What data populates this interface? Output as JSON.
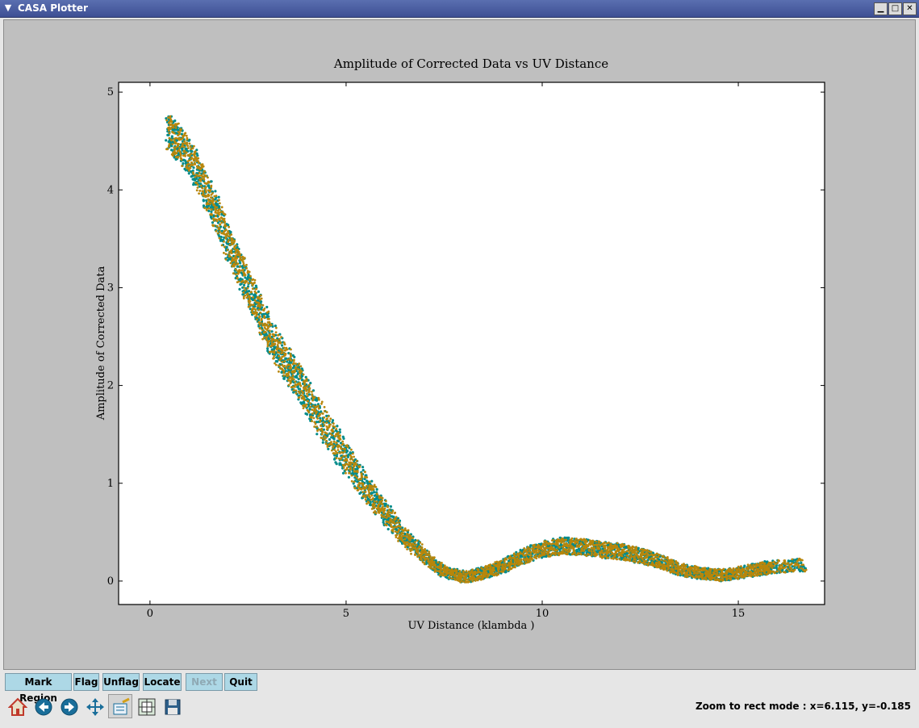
{
  "window": {
    "title": "CASA Plotter"
  },
  "plot": {
    "title": "Amplitude of Corrected Data vs UV Distance",
    "xlabel": "UV Distance (klambda )",
    "ylabel": "Amplitude of Corrected Data"
  },
  "chart_data": {
    "type": "scatter",
    "title": "Amplitude of Corrected Data vs UV Distance",
    "xlabel": "UV Distance (klambda )",
    "ylabel": "Amplitude of Corrected Data",
    "xlim": [
      -0.8,
      17.2
    ],
    "ylim": [
      -0.24,
      5.1
    ],
    "xticks": [
      "0",
      "5",
      "10",
      "15"
    ],
    "yticks": [
      "0",
      "1",
      "2",
      "3",
      "4",
      "5"
    ],
    "grid": false,
    "series": [
      {
        "color": "#008b8b",
        "x": [
          0.45,
          0.8,
          1.2,
          1.6,
          2.0,
          2.4,
          2.8,
          3.2,
          3.6,
          4.0,
          4.5,
          5.0,
          5.5,
          6.0,
          6.5,
          7.0,
          7.5,
          8.0,
          8.5,
          9.0,
          9.5,
          10.0,
          10.5,
          11.0,
          11.5,
          12.0,
          12.5,
          13.0,
          13.5,
          14.0,
          14.5,
          15.0,
          15.5,
          15.8,
          16.7
        ],
        "y": [
          4.6,
          4.45,
          4.2,
          3.85,
          3.45,
          3.1,
          2.75,
          2.4,
          2.15,
          1.9,
          1.55,
          1.25,
          0.95,
          0.7,
          0.45,
          0.25,
          0.1,
          0.04,
          0.08,
          0.15,
          0.25,
          0.32,
          0.36,
          0.35,
          0.32,
          0.3,
          0.26,
          0.2,
          0.12,
          0.08,
          0.06,
          0.08,
          0.12,
          0.14,
          0.17
        ]
      },
      {
        "color": "#b8860b",
        "x": [
          0.45,
          0.8,
          1.2,
          1.6,
          2.0,
          2.4,
          2.8,
          3.2,
          3.6,
          4.0,
          4.5,
          5.0,
          5.5,
          6.0,
          6.5,
          7.0,
          7.5,
          8.0,
          8.5,
          9.0,
          9.5,
          10.0,
          10.5,
          11.0,
          11.5,
          12.0,
          12.5,
          13.0,
          13.5,
          14.0,
          14.5,
          15.0,
          15.5,
          15.8,
          16.7
        ],
        "y": [
          4.6,
          4.45,
          4.2,
          3.85,
          3.45,
          3.1,
          2.75,
          2.4,
          2.15,
          1.9,
          1.55,
          1.25,
          0.95,
          0.7,
          0.45,
          0.25,
          0.1,
          0.04,
          0.08,
          0.15,
          0.25,
          0.32,
          0.36,
          0.35,
          0.32,
          0.3,
          0.26,
          0.2,
          0.12,
          0.08,
          0.06,
          0.08,
          0.12,
          0.14,
          0.17
        ]
      }
    ]
  },
  "buttons": {
    "mark_region": "Mark Region",
    "flag": "Flag",
    "unflag": "Unflag",
    "locate": "Locate",
    "next": "Next",
    "quit": "Quit"
  },
  "tools": [
    "home-icon",
    "back-icon",
    "forward-icon",
    "pan-icon",
    "zoom-icon",
    "subplots-icon",
    "save-icon"
  ],
  "status": {
    "text": "Zoom to rect mode : x=6.115, y=-0.185"
  }
}
